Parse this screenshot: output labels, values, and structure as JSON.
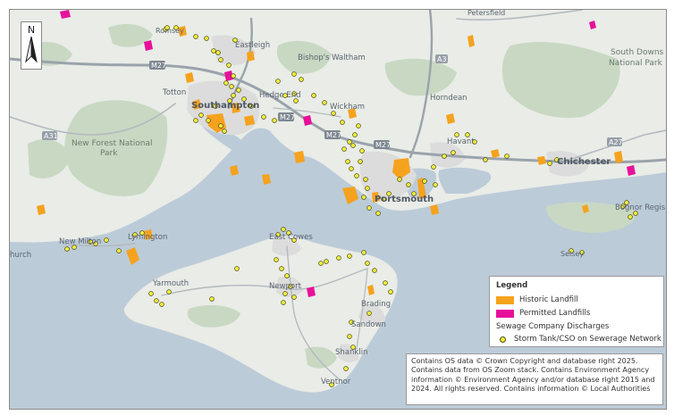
{
  "north_arrow": {
    "letter": "N",
    "icon": "north-arrow-icon"
  },
  "places": {
    "petersfield": "Petersfield",
    "romsey": "Romsey",
    "eastleigh": "Eastleigh",
    "bishops_waltham": "Bishop's Waltham",
    "south_downs": [
      "South Downs",
      "National Park"
    ],
    "totton": "Totton",
    "southampton": "Southampton",
    "hedge_end": "Hedge End",
    "wickham": "Wickham",
    "horndean": "Horndean",
    "new_forest": [
      "New Forest National",
      "Park"
    ],
    "havant": "Havant",
    "chichester": "Chichester",
    "portsmouth": "Portsmouth",
    "bognor": "Bognor Regis",
    "new_milton": "New Milton",
    "lymington": "Lymington",
    "east_cowes": "East Cowes",
    "christchurch": "hurch",
    "selsey": "Selsey",
    "yarmouth": "Yarmouth",
    "newport": "Newport",
    "brading": "Brading",
    "sandown": "Sandown",
    "shanklin": "Shanklin",
    "ventnor": "Ventnor"
  },
  "roads": {
    "m27a": "M27",
    "m27b": "M27",
    "m27c": "M27",
    "m27d": "M27",
    "a31": "A31",
    "a27": "A27",
    "a3": "A3"
  },
  "colors": {
    "land": "#e9ece7",
    "sea": "#bccbd8",
    "wood": "#c9d8c3",
    "urban": "#dcdcdc",
    "motorway": "#9aa3ab",
    "a_road": "#b3b9bf",
    "historic_landfill": "#f5a21e",
    "permitted_landfill": "#e8109a",
    "storm_tank": "#f2ef3e"
  },
  "legend": {
    "title": "Legend",
    "historic": "Historic Landfill",
    "permitted": "Permitted Landfills",
    "section": "Sewage Company Discharges",
    "storm": "Storm Tank/CSO on Sewerage Network"
  },
  "credits": [
    "Contains OS data © Crown Copyright and database right 2025.",
    "Contains data from OS Zoom stack. Contains Environment Agency",
    "information © Environment Agency and/or database right 2015 and",
    "2024. All rights reserved. Contains information © Local Authorities"
  ]
}
